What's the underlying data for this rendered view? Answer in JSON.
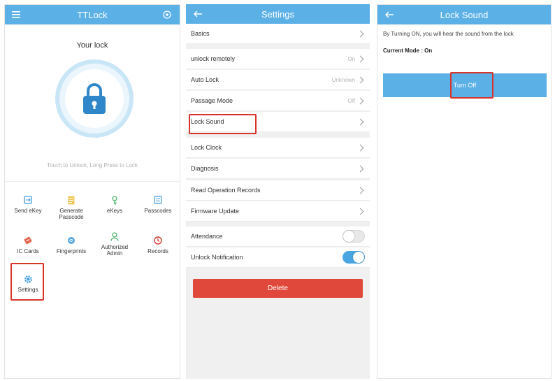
{
  "home": {
    "title": "TTLock",
    "your_lock": "Your lock",
    "hint": "Touch to Unlock, Long Press to Lock",
    "features": [
      {
        "label": "Send eKey",
        "icon": "send-ekey-icon"
      },
      {
        "label": "Generate Passcode",
        "icon": "generate-passcode-icon"
      },
      {
        "label": "eKeys",
        "icon": "ekeys-icon"
      },
      {
        "label": "Passcodes",
        "icon": "passcodes-icon"
      },
      {
        "label": "IC Cards",
        "icon": "ic-cards-icon"
      },
      {
        "label": "Fingerprints",
        "icon": "fingerprints-icon"
      },
      {
        "label": "Authorized Admin",
        "icon": "authorized-admin-icon"
      },
      {
        "label": "Records",
        "icon": "records-icon"
      },
      {
        "label": "Settings",
        "icon": "settings-icon"
      }
    ]
  },
  "settings": {
    "title": "Settings",
    "rows": [
      {
        "label": "Basics",
        "value": ""
      },
      {
        "label": "unlock remotely",
        "value": "On"
      },
      {
        "label": "Auto Lock",
        "value": "Unknown"
      },
      {
        "label": "Passage Mode",
        "value": "Off"
      },
      {
        "label": "Lock Sound",
        "value": ""
      },
      {
        "label": "Lock Clock",
        "value": ""
      },
      {
        "label": "Diagnosis",
        "value": ""
      },
      {
        "label": "Read Operation Records",
        "value": ""
      },
      {
        "label": "Firmware Update",
        "value": ""
      },
      {
        "label": "Attendance",
        "value": ""
      },
      {
        "label": "Unlock Notification",
        "value": ""
      }
    ],
    "delete_label": "Delete"
  },
  "lock_sound": {
    "title": "Lock Sound",
    "description": "By Turning ON, you will hear the sound from the lock",
    "current_mode": "Current Mode : On",
    "button_label": "Turn Off"
  },
  "colors": {
    "header_blue": "#5bb0e6",
    "delete_red": "#e0483b",
    "highlight_red": "#d9342b"
  }
}
